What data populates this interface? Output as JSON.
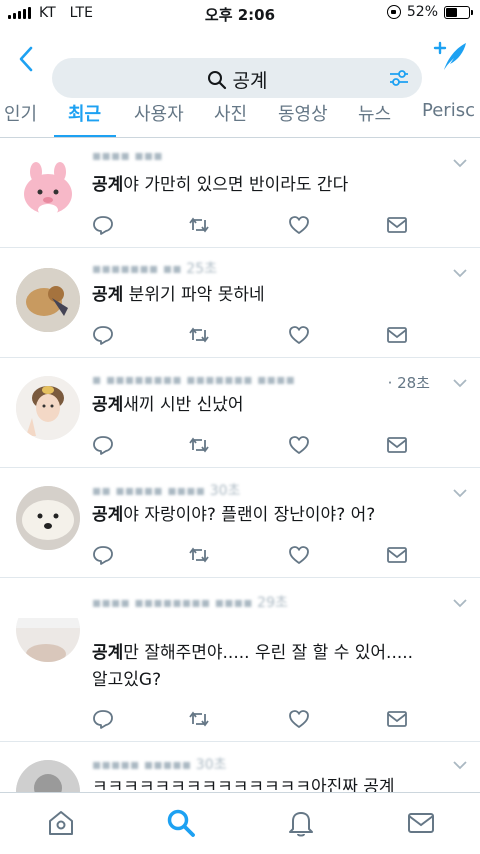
{
  "status_bar": {
    "carrier": "KT",
    "network": "LTE",
    "time": "오후 2:06",
    "battery_percent": "52%",
    "battery_level": 0.52
  },
  "header": {
    "back_icon": "chevron-left-icon",
    "search_query": "공계",
    "search_icon": "search-icon",
    "filter_icon": "sliders-icon",
    "compose_icon": "compose-tweet-icon"
  },
  "tabs": [
    {
      "label": "인기",
      "active": false
    },
    {
      "label": "최근",
      "active": true
    },
    {
      "label": "사용자",
      "active": false
    },
    {
      "label": "사진",
      "active": false
    },
    {
      "label": "동영상",
      "active": false
    },
    {
      "label": "뉴스",
      "active": false
    },
    {
      "label": "Perisc",
      "active": false
    }
  ],
  "tweets": [
    {
      "meta_time": "",
      "keyword": "공계",
      "rest": "야 가만히 있으면 반이라도 간다",
      "line2": ""
    },
    {
      "meta_time": "",
      "keyword": "공계",
      "rest": " 분위기 파악 못하네",
      "line2": ""
    },
    {
      "meta_time": "· 28초",
      "keyword": "공계",
      "rest": "새끼 시반 신났어",
      "line2": ""
    },
    {
      "meta_time": "",
      "keyword": "공계",
      "rest": "야 자랑이야? 플랜이 장난이야? 어?",
      "line2": ""
    },
    {
      "meta_time": "",
      "keyword": "공계",
      "rest": "만 잘해주면야..... 우린 잘 할 수 있어.....",
      "line2": "알고있G?"
    },
    {
      "meta_time": "",
      "keyword": "",
      "rest": "ㅋㅋㅋㅋㅋㅋㅋㅋㅋㅋㅋㅋㅋㅋ아진짜 공계",
      "line2": ""
    }
  ],
  "bottom_nav": [
    "home-icon",
    "search-icon",
    "notifications-bell-icon",
    "messages-envelope-icon"
  ],
  "colors": {
    "accent": "#1da1f2",
    "text": "#14171a",
    "secondary": "#657786",
    "icon_gray": "#657786",
    "search_bg": "#e6ecf0",
    "divider": "#e1e8ed"
  }
}
